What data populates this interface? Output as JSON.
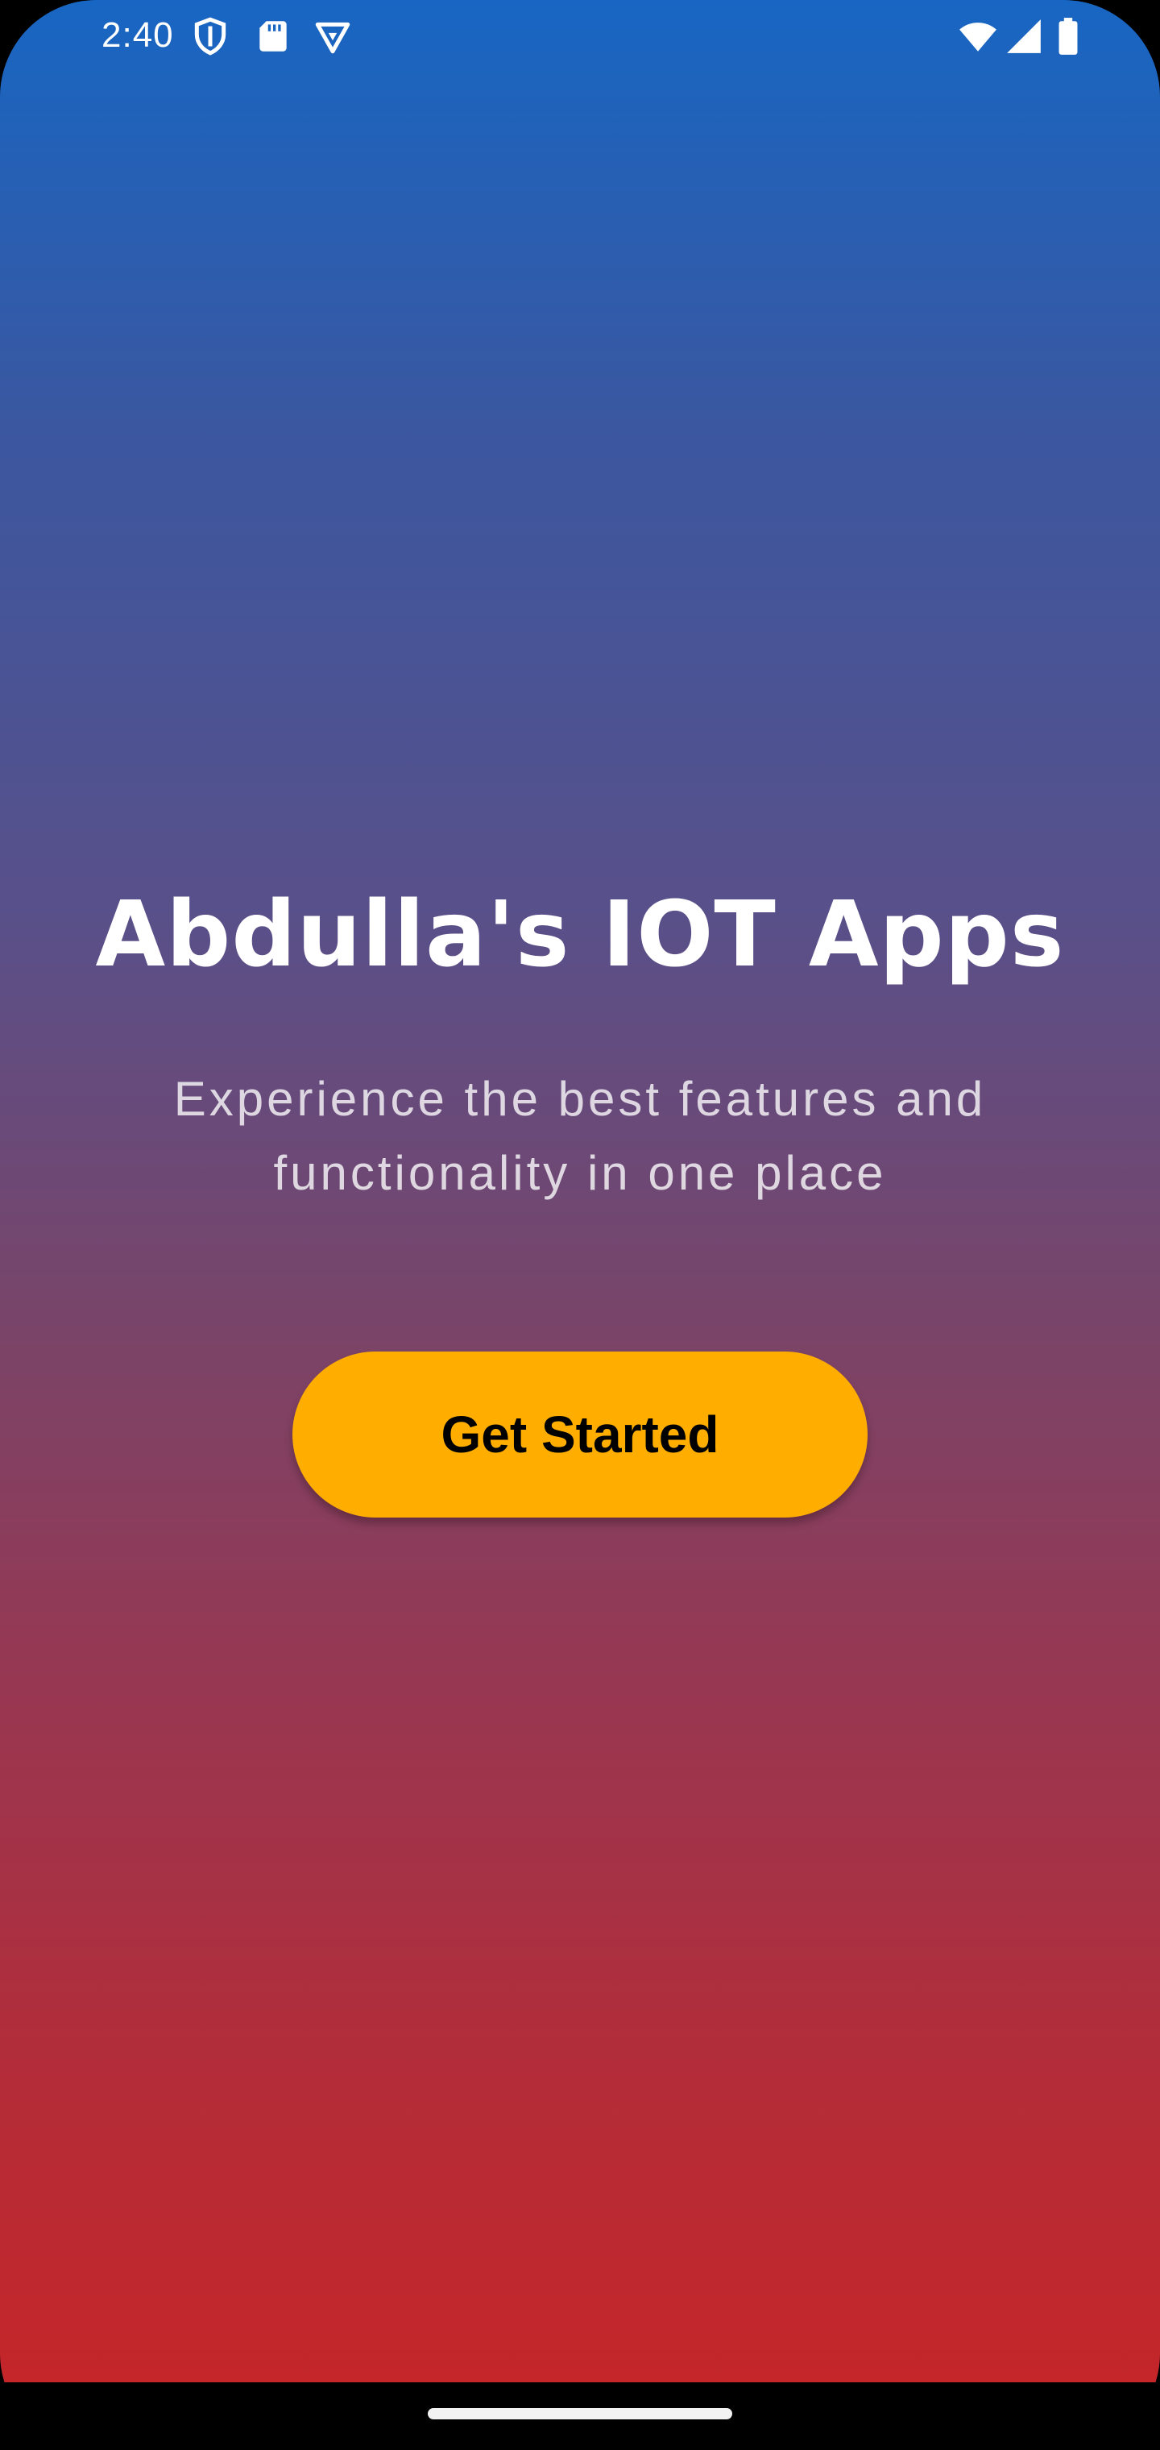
{
  "status_bar": {
    "time": "2:40",
    "left_icons": [
      "shield-icon",
      "sd-card-icon",
      "vpn-badge-icon"
    ],
    "right_icons": [
      "wifi-icon",
      "cellular-signal-icon",
      "battery-icon"
    ]
  },
  "main": {
    "title": "Abdulla's IOT Apps",
    "subtitle_line1": "Experience the best features and",
    "subtitle_line2": "functionality in one place",
    "cta_label": "Get Started"
  },
  "colors": {
    "gradient_top": "#1766c3",
    "gradient_bottom": "#c42629",
    "button": "#ffae00",
    "button_text": "#000000",
    "title_text": "#ffffff"
  }
}
